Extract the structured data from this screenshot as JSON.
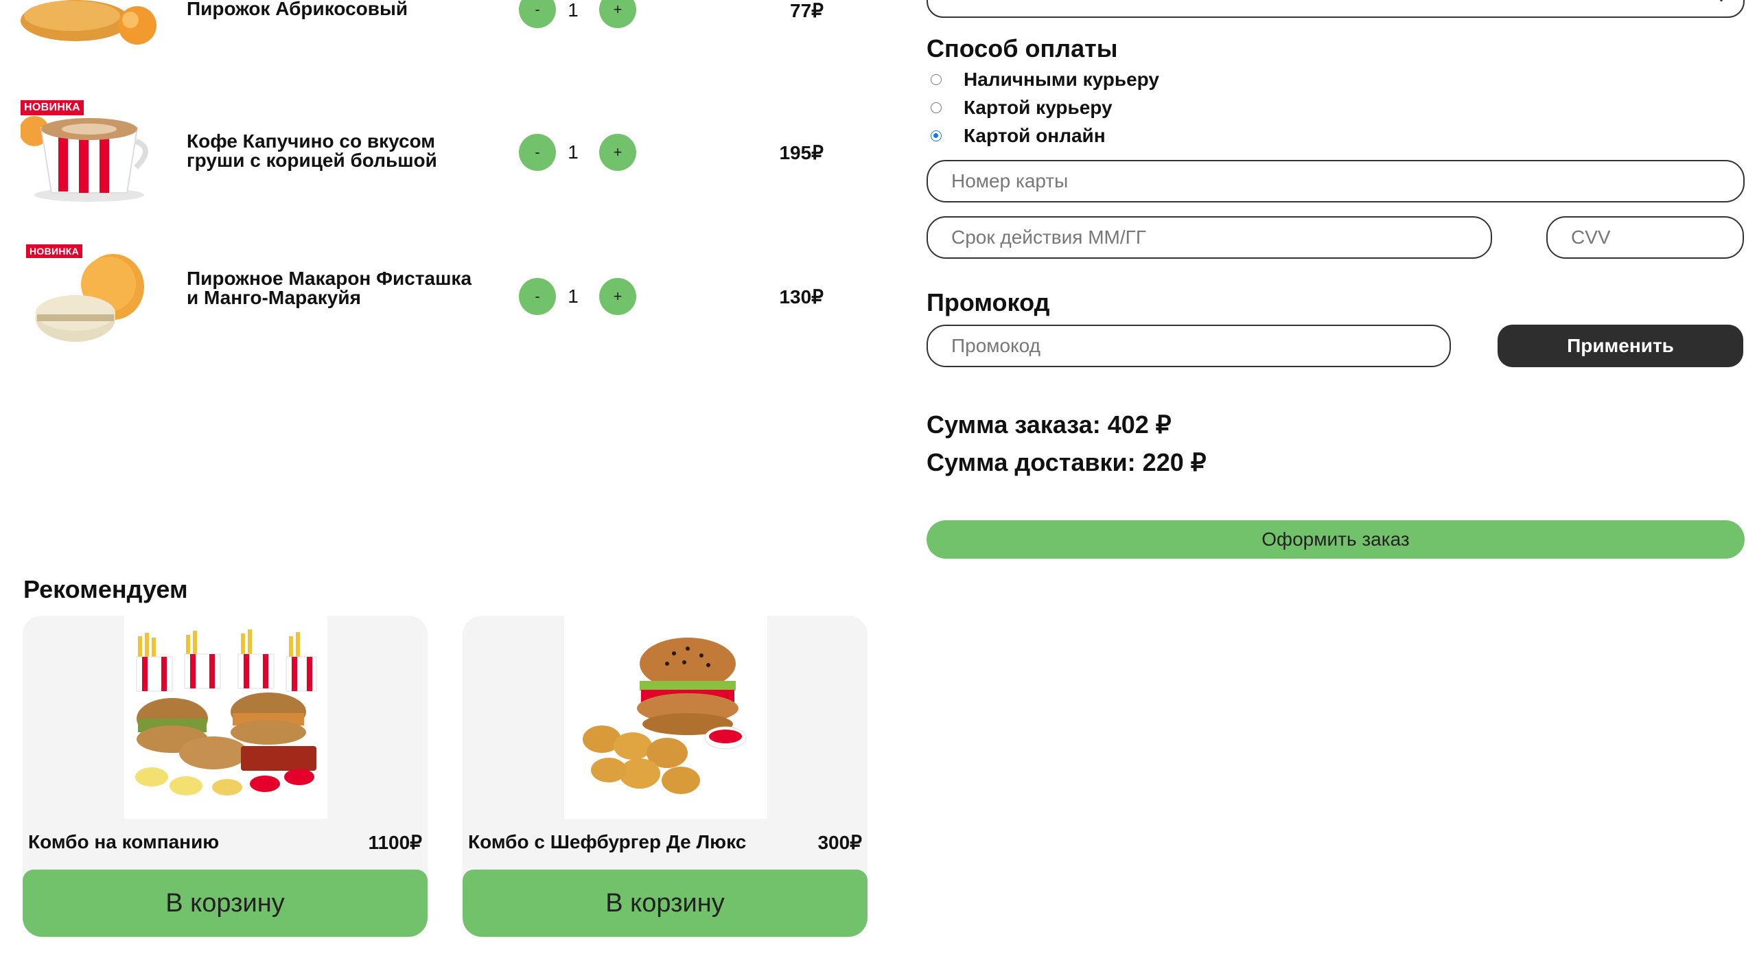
{
  "cart": {
    "items": [
      {
        "name": "Пирожок Абрикосовый",
        "qty": "1",
        "price": "77₽",
        "minus": "-",
        "plus": "+",
        "badge": ""
      },
      {
        "name": "Кофе Капучино со вкусом груши с корицей большой",
        "qty": "1",
        "price": "195₽",
        "minus": "-",
        "plus": "+",
        "badge": "НОВИНКА"
      },
      {
        "name": "Пирожное Макарон Фисташка и Манго-Маракуйя",
        "qty": "1",
        "price": "130₽",
        "minus": "-",
        "plus": "+",
        "badge": "НОВИНКА"
      }
    ]
  },
  "recommend": {
    "title": "Рекомендуем",
    "cards": [
      {
        "name": "Комбо на компанию",
        "price": "1100₽",
        "button": "В корзину"
      },
      {
        "name": "Комбо с Шефбургер Де Люкс",
        "price": "300₽",
        "button": "В корзину"
      }
    ]
  },
  "payment": {
    "title": "Способ оплаты",
    "options": [
      {
        "label": "Наличными курьеру",
        "checked": false
      },
      {
        "label": "Картой курьеру",
        "checked": false
      },
      {
        "label": "Картой онлайн",
        "checked": true
      }
    ],
    "card_number_placeholder": "Номер карты",
    "expiry_placeholder": "Срок действия ММ/ГГ",
    "cvv_placeholder": "CVV"
  },
  "promo": {
    "title": "Промокод",
    "placeholder": "Промокод",
    "apply": "Применить"
  },
  "summary": {
    "order_sum": "Сумма заказа: 402 ₽",
    "delivery_sum": "Сумма доставки: 220 ₽",
    "checkout": "Оформить заказ"
  },
  "colors": {
    "accent_green": "#72c26b",
    "dark_button": "#2e2e2e",
    "badge_red": "#e4002b",
    "radio_blue": "#1a73e8"
  }
}
